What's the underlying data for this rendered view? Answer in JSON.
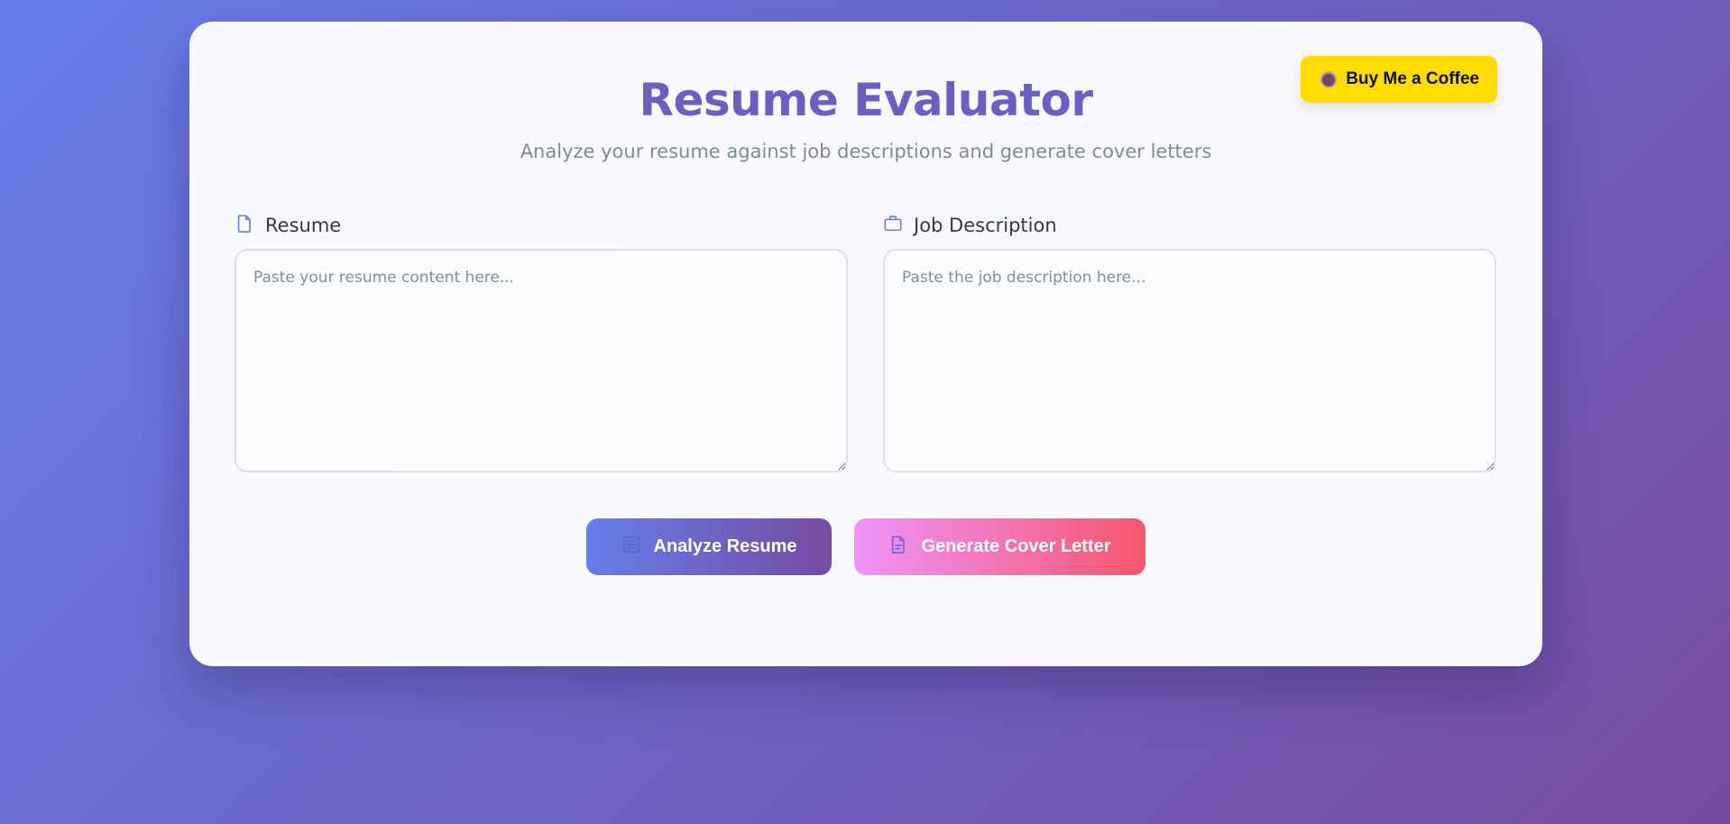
{
  "header": {
    "title": "Resume Evaluator",
    "subtitle": "Analyze your resume against job descriptions and generate cover letters",
    "coffee_button": {
      "label": "Buy Me a Coffee",
      "icon": "coffee-icon",
      "color": "#ffdd00"
    }
  },
  "fields": {
    "resume": {
      "label": "Resume",
      "icon": "document-icon",
      "value": "",
      "placeholder": "Paste your resume content here..."
    },
    "job": {
      "label": "Job Description",
      "icon": "briefcase-icon",
      "value": "",
      "placeholder": "Paste the job description here..."
    }
  },
  "actions": {
    "analyze": {
      "label": "Analyze Resume",
      "icon": "list-icon"
    },
    "cover_letter": {
      "label": "Generate Cover Letter",
      "icon": "file-text-icon"
    }
  },
  "colors": {
    "accent": "#6b5fc4",
    "background_start": "#667eea",
    "background_end": "#764ba2",
    "cover_start": "#f093fb",
    "cover_end": "#f5576c"
  }
}
